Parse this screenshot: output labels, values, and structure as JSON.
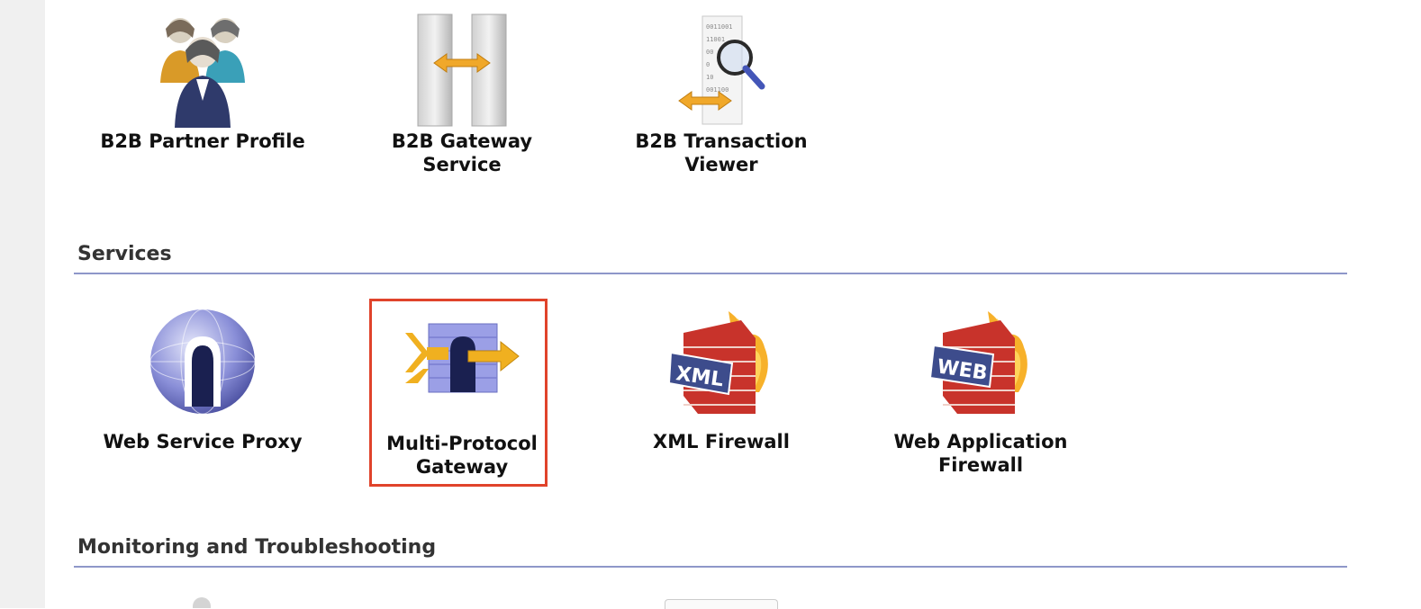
{
  "b2b": {
    "tiles": [
      {
        "label": "B2B Partner Profile",
        "icon": "b2b-partner-profile-icon"
      },
      {
        "label": "B2B Gateway Service",
        "icon": "b2b-gateway-service-icon"
      },
      {
        "label": "B2B Transaction Viewer",
        "icon": "b2b-transaction-viewer-icon"
      }
    ]
  },
  "services": {
    "heading": "Services",
    "tiles": [
      {
        "label": "Web Service Proxy",
        "icon": "globe-gateway-icon"
      },
      {
        "label": "Multi-Protocol Gateway",
        "icon": "multi-protocol-gateway-icon",
        "selected": true
      },
      {
        "label": "XML Firewall",
        "icon": "xml-firewall-icon"
      },
      {
        "label": "Web Application Firewall",
        "icon": "web-application-firewall-icon"
      }
    ]
  },
  "monitoring": {
    "heading": "Monitoring and Troubleshooting"
  },
  "colors": {
    "section_rule": "#8e97c9",
    "highlight": "#e0432b",
    "gutter": "#f0f0f0"
  }
}
